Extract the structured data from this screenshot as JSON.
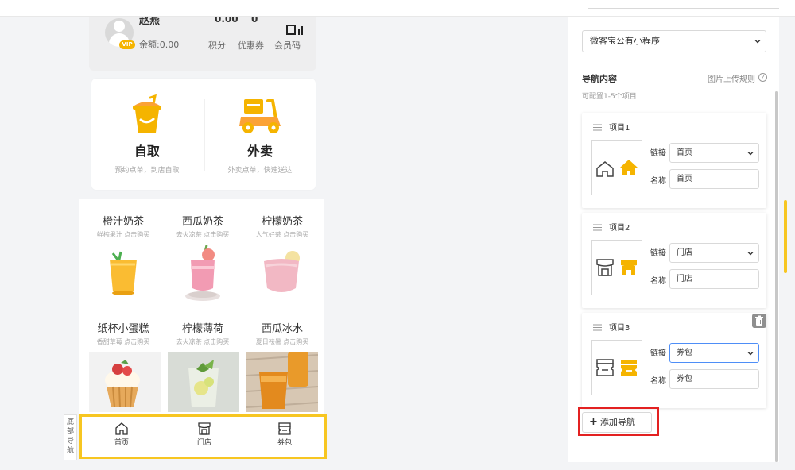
{
  "user": {
    "name": "赵燕",
    "vip_badge": "VIP",
    "balance": "余额:0.00",
    "points_value": "0.00",
    "coupons_value": "0",
    "points_label": "积分",
    "coupons_label": "优惠券",
    "member_code_label": "会员码"
  },
  "order": {
    "pickup_title": "自取",
    "pickup_sub": "预约点单，到店自取",
    "delivery_title": "外卖",
    "delivery_sub": "外卖点单，快速送达"
  },
  "products": [
    {
      "name": "橙汁奶茶",
      "desc": "鲜榨果汁 点击购买"
    },
    {
      "name": "西瓜奶茶",
      "desc": "去火凉茶 点击购买"
    },
    {
      "name": "柠檬奶茶",
      "desc": "人气好茶 点击购买"
    },
    {
      "name": "纸杯小蛋糕",
      "desc": "香甜草莓 点击购买"
    },
    {
      "name": "柠檬薄荷",
      "desc": "去火凉茶 点击购买"
    },
    {
      "name": "西瓜冰水",
      "desc": "夏日祛暑 点击购买"
    }
  ],
  "side_tab": "底部导航",
  "bottom_nav": [
    {
      "label": "首页",
      "icon": "home-icon"
    },
    {
      "label": "门店",
      "icon": "store-icon"
    },
    {
      "label": "券包",
      "icon": "ticket-icon"
    }
  ],
  "panel": {
    "app_select": "微客宝公有小程序",
    "section_title": "导航内容",
    "upload_rule": "图片上传规则",
    "question_mark": "?",
    "hint": "可配置1-5个项目",
    "link_label": "链接",
    "name_label": "名称",
    "add_button": "添加导航",
    "add_plus": "+",
    "items": [
      {
        "title": "项目1",
        "link": "首页",
        "name": "首页",
        "icon": "home-icon"
      },
      {
        "title": "项目2",
        "link": "门店",
        "name": "门店",
        "icon": "store-icon"
      },
      {
        "title": "项目3",
        "link": "券包",
        "name": "券包",
        "icon": "ticket-icon"
      }
    ]
  },
  "colors": {
    "accent": "#f7c621",
    "icon_yellow": "#f5b400",
    "orange": "#fba236",
    "highlight_red": "#e32121",
    "focus_blue": "#4e8ef7"
  }
}
